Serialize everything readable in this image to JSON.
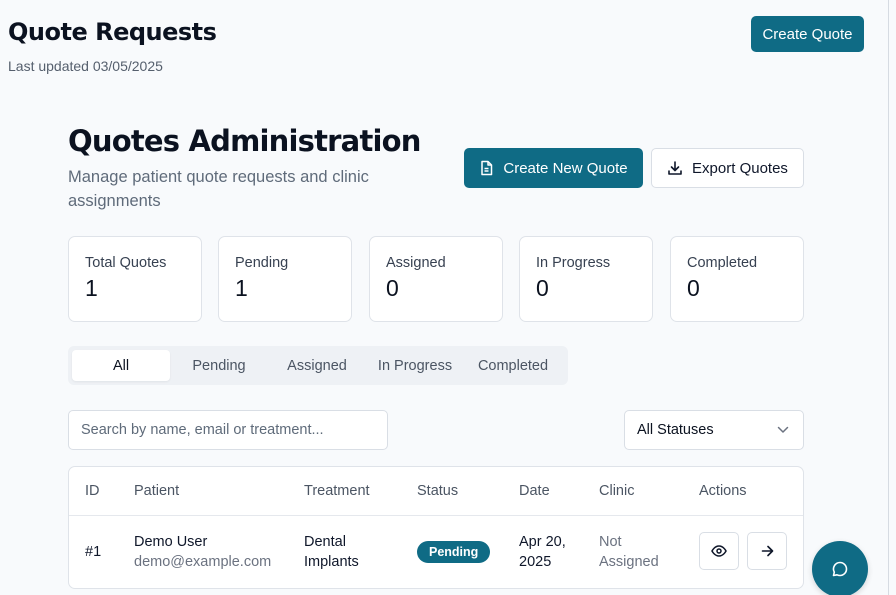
{
  "header": {
    "title": "Quote Requests",
    "last_updated": "Last updated 03/05/2025",
    "create_button": "Create Quote"
  },
  "admin": {
    "title": "Quotes Administration",
    "subtitle": "Manage patient quote requests and clinic assignments",
    "create_new_button": "Create New Quote",
    "export_button": "Export Quotes"
  },
  "stats": [
    {
      "label": "Total Quotes",
      "value": "1"
    },
    {
      "label": "Pending",
      "value": "1"
    },
    {
      "label": "Assigned",
      "value": "0"
    },
    {
      "label": "In Progress",
      "value": "0"
    },
    {
      "label": "Completed",
      "value": "0"
    }
  ],
  "tabs": [
    {
      "label": "All",
      "active": true
    },
    {
      "label": "Pending"
    },
    {
      "label": "Assigned"
    },
    {
      "label": "In Progress"
    },
    {
      "label": "Completed"
    }
  ],
  "filters": {
    "search_placeholder": "Search by name, email or treatment...",
    "status_select": "All Statuses"
  },
  "table": {
    "columns": [
      "ID",
      "Patient",
      "Treatment",
      "Status",
      "Date",
      "Clinic",
      "Actions"
    ],
    "rows": [
      {
        "id": "#1",
        "patient_name": "Demo User",
        "patient_email": "demo@example.com",
        "treatment_line1": "Dental",
        "treatment_line2": "Implants",
        "status": "Pending",
        "date_line1": "Apr 20,",
        "date_line2": "2025",
        "clinic_line1": "Not",
        "clinic_line2": "Assigned"
      }
    ]
  },
  "icons": {
    "file": "file-icon",
    "download": "download-icon",
    "chevron": "chevron-down-icon",
    "view": "eye-icon",
    "go": "arrow-right-icon",
    "chat": "chat-icon"
  },
  "colors": {
    "accent": "#0f6b85",
    "background": "#f8fafc"
  }
}
